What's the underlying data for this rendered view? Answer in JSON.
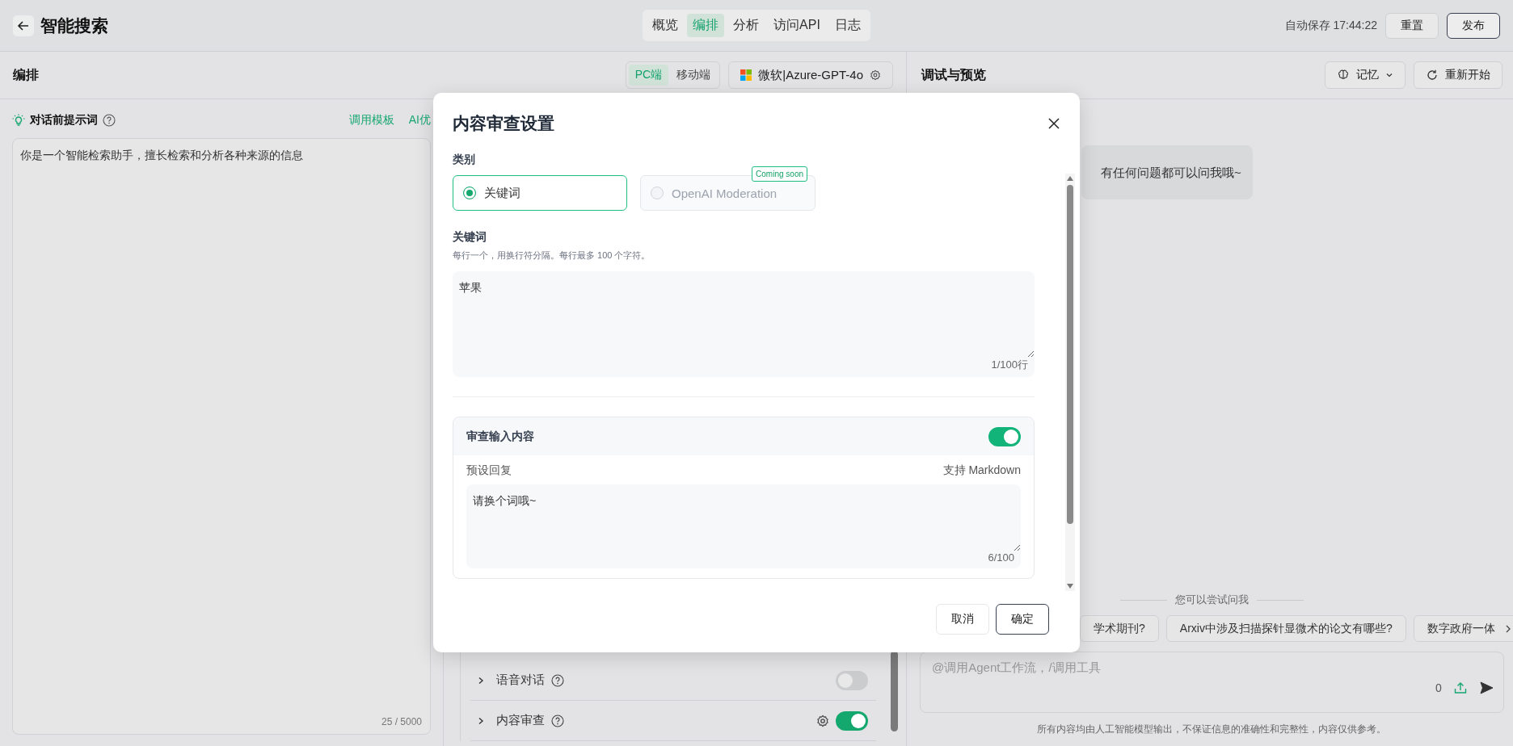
{
  "header": {
    "title": "智能搜索",
    "tabs": [
      {
        "label": "概览",
        "selected": false
      },
      {
        "label": "编排",
        "selected": true
      },
      {
        "label": "分析",
        "selected": false
      },
      {
        "label": "访问API",
        "selected": false
      },
      {
        "label": "日志",
        "selected": false
      }
    ],
    "autosave": "自动保存 17:44:22",
    "reset_button": "重置",
    "publish_button": "发布"
  },
  "editor": {
    "title": "编排",
    "device_tabs": [
      {
        "label": "PC端",
        "selected": true
      },
      {
        "label": "移动端",
        "selected": false
      }
    ],
    "model": "微软|Azure-GPT-4o",
    "prompt": {
      "label": "对话前提示词",
      "actions": [
        "调用模板",
        "AI优"
      ],
      "value": "你是一个智能检索助手，擅长检索和分析各种来源的信息",
      "counter": "25 / 5000"
    },
    "features": [
      {
        "label": "语音对话",
        "on": false,
        "has_settings": false
      },
      {
        "label": "内容审查",
        "on": true,
        "has_settings": true
      }
    ]
  },
  "preview": {
    "title": "调试与预览",
    "memory_button": "记忆",
    "restart_button": "重新开始",
    "greeting": "有任何问题都可以问我哦~",
    "suggestions_label": "您可以尝试问我",
    "suggestions": [
      "学术期刊?",
      "Arxiv中涉及扫描探针显微术的论文有哪些?",
      "数字政府一体"
    ],
    "input_placeholder": "@调用Agent工作流，/调用工具",
    "char_count": "0",
    "disclaimer": "所有内容均由人工智能模型输出，不保证信息的准确性和完整性，内容仅供参考。"
  },
  "dialog": {
    "title": "内容审查设置",
    "category_label": "类别",
    "categories": [
      {
        "label": "关键词",
        "selected": true,
        "disabled": false
      },
      {
        "label": "OpenAI Moderation",
        "selected": false,
        "disabled": true,
        "badge": "Coming soon"
      }
    ],
    "keywords_label": "关键词",
    "keywords_hint": "每行一个，用换行符分隔。每行最多 100 个字符。",
    "keywords_value": "苹果",
    "keywords_counter": "1/100行",
    "input_review": {
      "label": "审查输入内容",
      "on": true,
      "reply_label": "预设回复",
      "reply_note": "支持 Markdown",
      "reply_value": "请换个词哦~",
      "reply_counter": "6/100"
    },
    "buttons": [
      {
        "label": "取消",
        "kind": "secondary"
      },
      {
        "label": "确定",
        "kind": "primary"
      }
    ]
  }
}
